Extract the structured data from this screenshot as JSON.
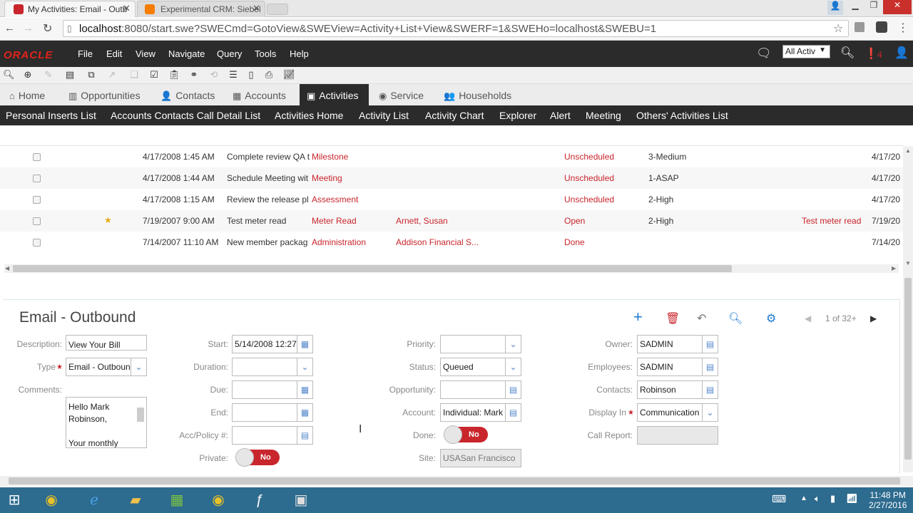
{
  "browser": {
    "tabs": [
      {
        "label": "My Activities: Email - Outb",
        "active": true
      },
      {
        "label": "Experimental CRM: Siebel",
        "active": false
      }
    ],
    "url_host": "localhost",
    "url_rest": ":8080/start.swe?SWECmd=GotoView&SWEView=Activity+List+View&SWERF=1&SWEHo=localhost&SWEBU=1"
  },
  "app": {
    "logo": "ORACLE",
    "menu": [
      "File",
      "Edit",
      "View",
      "Navigate",
      "Query",
      "Tools",
      "Help"
    ],
    "search_scope": "All Activ",
    "notification_count": "4"
  },
  "screen_tabs": [
    "Home",
    "Opportunities",
    "Contacts",
    "Accounts",
    "Activities",
    "Service",
    "Households"
  ],
  "view_tabs": [
    "Personal Inserts List",
    "Accounts Contacts Call Detail List",
    "Activities Home",
    "Activity List",
    "Activity Chart",
    "Explorer",
    "Alert",
    "Meeting",
    "Others' Activities List"
  ],
  "list_rows": [
    {
      "date": "4/17/2008 1:45 AM",
      "description": "Complete review QA t",
      "type": "Milestone",
      "contact": "",
      "status": "Unscheduled",
      "priority": "3-Medium",
      "extra": "",
      "due": "4/17/20",
      "starred": false
    },
    {
      "date": "4/17/2008 1:44 AM",
      "description": "Schedule Meeting wit",
      "type": "Meeting",
      "contact": "",
      "status": "Unscheduled",
      "priority": "1-ASAP",
      "extra": "",
      "due": "4/17/20",
      "starred": false
    },
    {
      "date": "4/17/2008 1:15 AM",
      "description": "Review the release pl",
      "type": "Assessment",
      "contact": "",
      "status": "Unscheduled",
      "priority": "2-High",
      "extra": "",
      "due": "4/17/20",
      "starred": false
    },
    {
      "date": "7/19/2007 9:00 AM",
      "description": "Test meter read",
      "type": "Meter Read",
      "contact": "Arnett, Susan",
      "status": "Open",
      "priority": "2-High",
      "extra": "Test meter read",
      "due": "7/19/20",
      "starred": true
    },
    {
      "date": "7/14/2007 11:10 AM",
      "description": "New member packag",
      "type": "Administration",
      "contact": "Addison Financial S...",
      "status": "Done",
      "priority": "",
      "extra": "",
      "due": "7/14/20",
      "starred": false
    }
  ],
  "form": {
    "title": "Email - Outbound",
    "pager": "1 of 32+",
    "labels": {
      "description": "Description:",
      "type": "Type",
      "comments": "Comments:",
      "start": "Start:",
      "duration": "Duration:",
      "due": "Due:",
      "end": "End:",
      "acc_policy": "Acc/Policy #:",
      "private": "Private:",
      "priority": "Priority:",
      "status": "Status:",
      "opportunity": "Opportunity:",
      "account": "Account:",
      "done": "Done:",
      "site": "Site:",
      "owner": "Owner:",
      "employees": "Employees:",
      "contacts": "Contacts:",
      "display_in": "Display In",
      "call_report": "Call Report:"
    },
    "values": {
      "description": "View Your Bill",
      "type": "Email - Outboun",
      "comments_line1": "Hello Mark",
      "comments_line2": "Robinson,",
      "comments_line3": "Your monthly",
      "start": "5/14/2008 12:27",
      "duration": "",
      "due": "",
      "end": "",
      "acc_policy": "",
      "private": "No",
      "priority": "",
      "status": "Queued",
      "opportunity": "",
      "account": "Individual: Mark",
      "done": "No",
      "site": "USASan Francisco",
      "owner": "SADMIN",
      "employees": "SADMIN",
      "contacts": "Robinson",
      "display_in": "Communication",
      "call_report": ""
    }
  },
  "taskbar": {
    "time": "11:48 PM",
    "date": "2/27/2016"
  },
  "colors": {
    "accent_red": "#c9252c",
    "dark_bar": "#2b2b2b",
    "oracle_red": "#e2231a"
  }
}
